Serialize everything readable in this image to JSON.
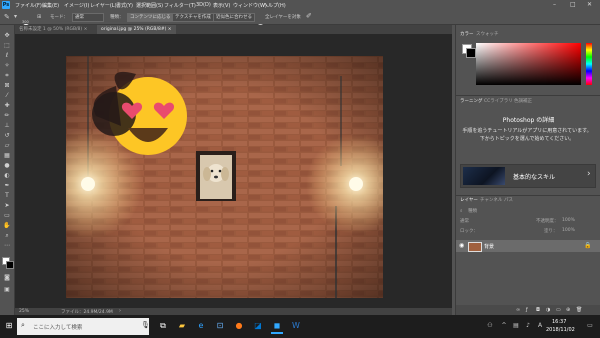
{
  "app": {
    "logo_text": "Ps"
  },
  "menu": [
    "ファイル(F)",
    "編集(E)",
    "イメージ(I)",
    "レイヤー(L)",
    "書式(Y)",
    "選択範囲(S)",
    "フィルター(T)",
    "3D(D)",
    "表示(V)",
    "ウィンドウ(W)",
    "ヘルプ(H)"
  ],
  "window_controls": {
    "minimize": "–",
    "maximize": "□",
    "close": "✕"
  },
  "options": {
    "brush_size": "300",
    "mode_label": "モード：",
    "mode_value": "通常",
    "sample_label": "種類：",
    "content_aware_btn": "コンテンツに応じる",
    "create_texture_btn": "テクスチャを作成",
    "proximity_btn": "近似色に合わせる",
    "sample_all_label": "全レイヤーを対象"
  },
  "doc_tabs": [
    {
      "label": "名称未設定 1 @ 50% (RGB/8) ×",
      "active": false
    },
    {
      "label": "original.jpg @ 25% (RGB/8#) ×",
      "active": true
    }
  ],
  "status": {
    "zoom": "25%",
    "doc_info": "ファイル：24.9M/24.9M"
  },
  "color_panel": {
    "tabs": [
      "カラー",
      "スウォッチ"
    ],
    "accent": "#ff0000"
  },
  "learn_panel": {
    "tabs": [
      "ラーニング",
      "CCライブラリ",
      "色調補正"
    ],
    "title": "Photoshop の詳細",
    "description": "手順を追うチュートリアルがアプリに用意されています。下からトピックを選んで始めてください。",
    "card_label": "基本的なスキル",
    "card_arrow": "›"
  },
  "layers_panel": {
    "tabs": [
      "レイヤー",
      "チャンネル",
      "パス"
    ],
    "search_label": "種類",
    "blend_mode": "通常",
    "opacity_label": "不透明度：",
    "opacity": "100%",
    "lock_label": "ロック：",
    "fill_label": "塗り：",
    "fill": "100%",
    "layers": [
      {
        "name": "背景",
        "visible": true,
        "locked": true
      }
    ]
  },
  "taskbar": {
    "search_placeholder": "ここに入力して検索",
    "time": "16:37",
    "date": "2018/11/02",
    "ime": "A"
  }
}
